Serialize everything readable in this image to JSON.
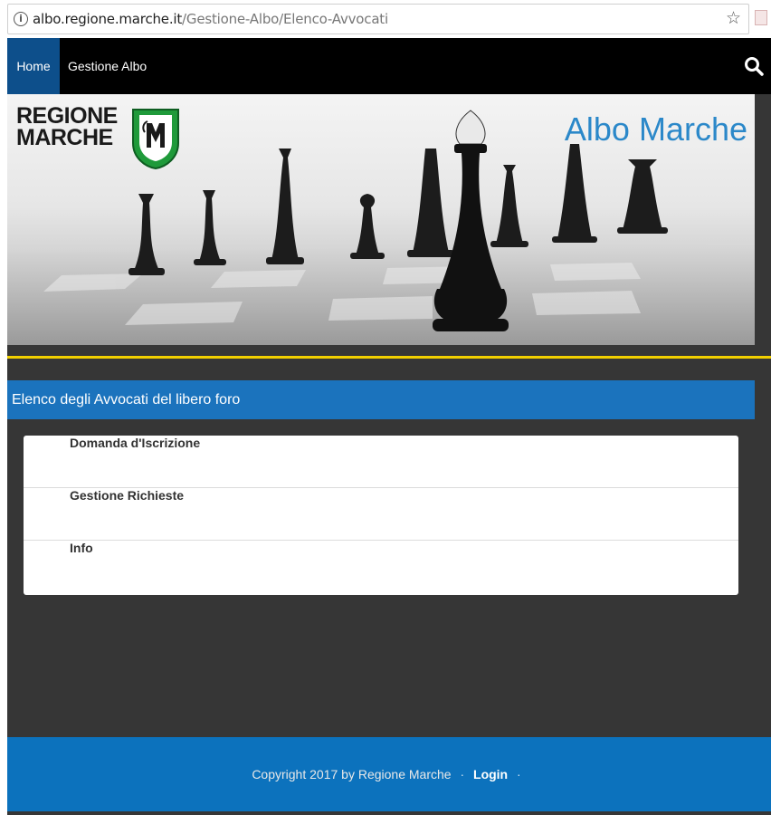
{
  "browser": {
    "url_host": "albo.regione.marche.it",
    "url_path": "/Gestione-Albo/Elenco-Avvocati"
  },
  "nav": {
    "home": "Home",
    "gestione": "Gestione Albo"
  },
  "banner": {
    "logo_line1": "REGIONE",
    "logo_line2": "MARCHE",
    "title": "Albo Marche"
  },
  "section": {
    "title": "Elenco degli Avvocati del libero foro"
  },
  "menu": {
    "items": [
      "Domanda d'Iscrizione",
      "Gestione Richieste",
      "Info"
    ]
  },
  "footer": {
    "copyright": "Copyright 2017 by Regione Marche",
    "separator": "·",
    "login": "Login"
  },
  "colors": {
    "nav_active": "#0d4f8b",
    "section_blue": "#1b73bd",
    "footer_blue": "#0c72bd",
    "accent_yellow": "#f2d000",
    "title_blue": "#2b88c9"
  }
}
